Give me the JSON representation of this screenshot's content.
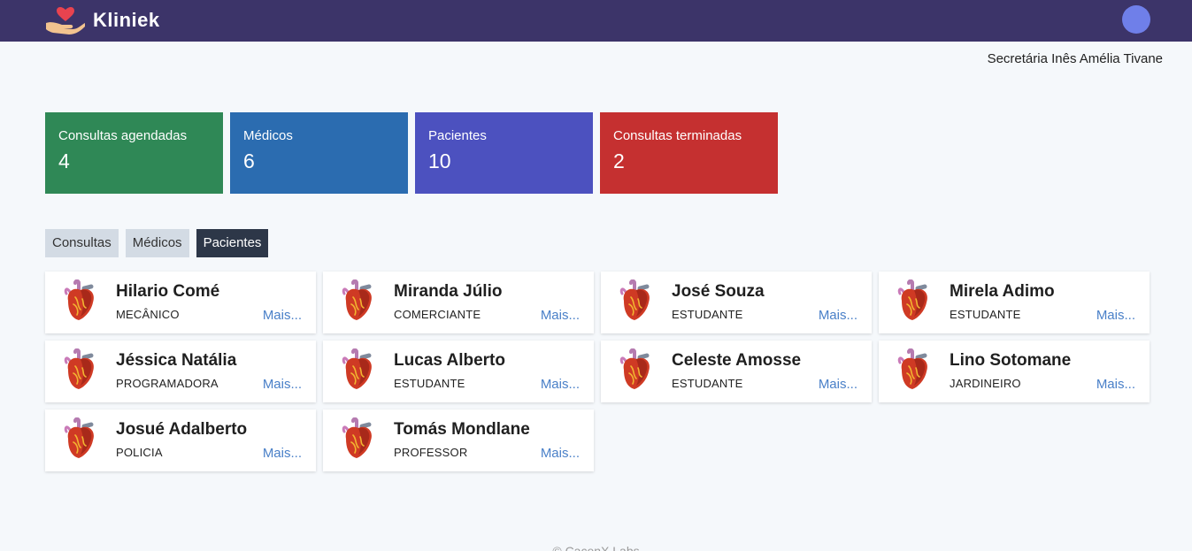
{
  "header": {
    "brand": "Kliniek",
    "logo_icon": "heart-hand-icon",
    "avatar_color": "#6f7fe9"
  },
  "user": {
    "display": "Secretária Inês Amélia Tivane"
  },
  "stats": [
    {
      "label": "Consultas agendadas",
      "value": "4",
      "color": "#2f8856"
    },
    {
      "label": "Médicos",
      "value": "6",
      "color": "#2b6cb0"
    },
    {
      "label": "Pacientes",
      "value": "10",
      "color": "#4c51bf"
    },
    {
      "label": "Consultas terminadas",
      "value": "2",
      "color": "#c53030"
    }
  ],
  "tabs": [
    {
      "label": "Consultas",
      "active": false
    },
    {
      "label": "Médicos",
      "active": false
    },
    {
      "label": "Pacientes",
      "active": true
    }
  ],
  "patients": [
    {
      "name": "Hilario Comé",
      "job": "MECÂNICO",
      "more": "Mais..."
    },
    {
      "name": "Miranda Júlio",
      "job": "COMERCIANTE",
      "more": "Mais..."
    },
    {
      "name": "José Souza",
      "job": "ESTUDANTE",
      "more": "Mais..."
    },
    {
      "name": "Mirela Adimo",
      "job": "ESTUDANTE",
      "more": "Mais..."
    },
    {
      "name": "Jéssica Natália",
      "job": "PROGRAMADORA",
      "more": "Mais..."
    },
    {
      "name": "Lucas Alberto",
      "job": "ESTUDANTE",
      "more": "Mais..."
    },
    {
      "name": "Celeste Amosse",
      "job": "ESTUDANTE",
      "more": "Mais..."
    },
    {
      "name": "Lino Sotomane",
      "job": "JARDINEIRO",
      "more": "Mais..."
    },
    {
      "name": "Josué Adalberto",
      "job": "POLICIA",
      "more": "Mais..."
    },
    {
      "name": "Tomás Mondlane",
      "job": "PROFESSOR",
      "more": "Mais..."
    }
  ],
  "card_icon": "anatomical-heart-icon",
  "footer": {
    "text": "© CacenX Labs"
  }
}
